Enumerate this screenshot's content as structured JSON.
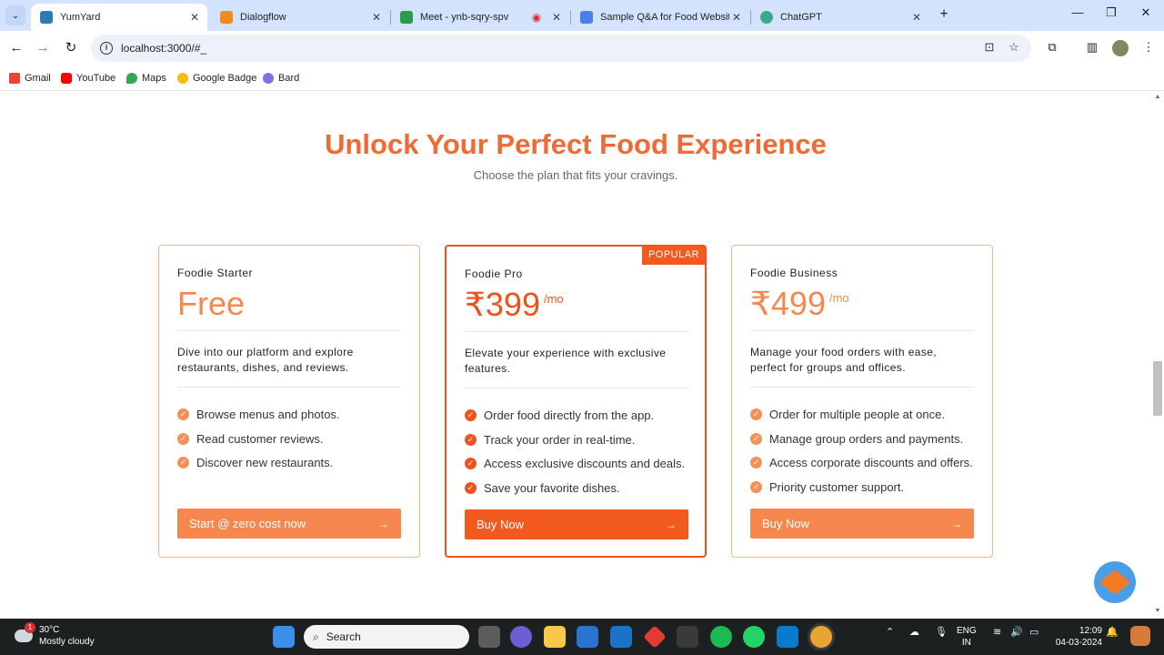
{
  "browser": {
    "tabs": [
      {
        "title": "YumYard",
        "active": true
      },
      {
        "title": "Dialogflow",
        "active": false
      },
      {
        "title": "Meet - ynb-sqry-spv",
        "active": false
      },
      {
        "title": "Sample Q&A for Food Website",
        "active": false
      },
      {
        "title": "ChatGPT",
        "active": false
      }
    ],
    "url": "localhost:3000/#_",
    "bookmarks": [
      "Gmail",
      "YouTube",
      "Maps",
      "Google Badge",
      "Bard"
    ]
  },
  "page": {
    "heading": "Unlock Your Perfect Food Experience",
    "subheading": "Choose the plan that fits your cravings.",
    "plans": [
      {
        "name": "Foodie Starter",
        "price": "Free",
        "period": "",
        "description": "Dive into our platform and explore restaurants, dishes, and reviews.",
        "features": [
          "Browse menus and photos.",
          "Read customer reviews.",
          "Discover new restaurants."
        ],
        "cta": "Start @ zero cost now"
      },
      {
        "name": "Foodie Pro",
        "badge": "POPULAR",
        "price": "₹399",
        "period": "/mo",
        "description": "Elevate your experience with exclusive features.",
        "features": [
          "Order food directly from the app.",
          "Track your order in real-time.",
          "Access exclusive discounts and deals.",
          "Save your favorite dishes."
        ],
        "cta": "Buy Now"
      },
      {
        "name": "Foodie Business",
        "price": "₹499",
        "period": "/mo",
        "description": "Manage your food orders with ease, perfect for groups and offices.",
        "features": [
          "Order for multiple people at once.",
          "Manage group orders and payments.",
          "Access corporate discounts and offers.",
          "Priority customer support."
        ],
        "cta": "Buy Now"
      }
    ]
  },
  "taskbar": {
    "weather_temp": "30°C",
    "weather_desc": "Mostly cloudy",
    "weather_badge": "1",
    "search_label": "Search",
    "lang_1": "ENG",
    "lang_2": "IN",
    "time": "12:09",
    "date": "04-03-2024"
  },
  "colors": {
    "accent": "#f26a33",
    "accent_strong": "#f0511d",
    "accent_soft": "#f6884f"
  }
}
